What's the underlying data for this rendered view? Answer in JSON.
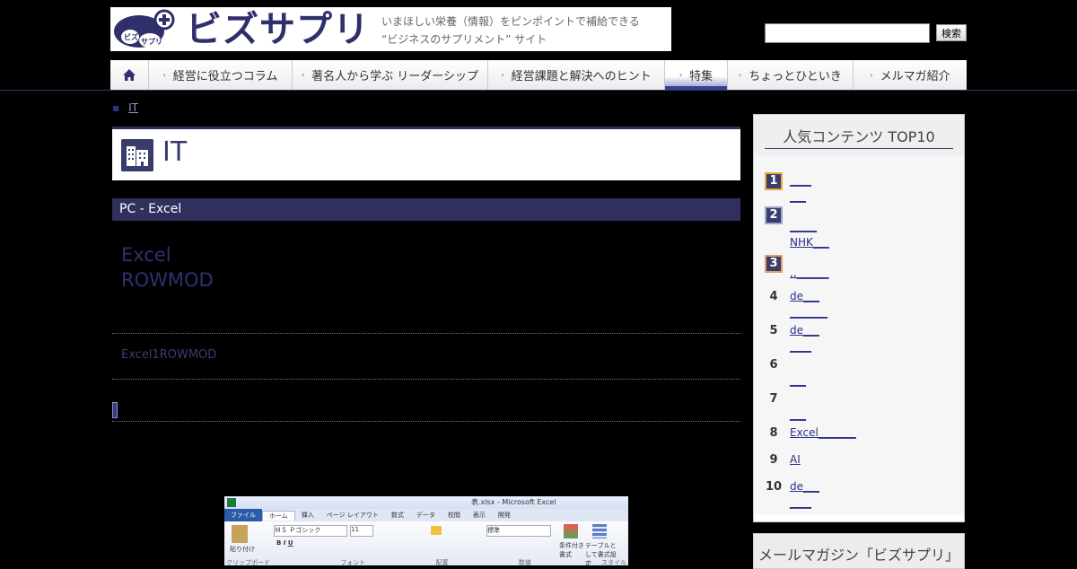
{
  "header": {
    "logo_text": "ビズサプリ",
    "tagline_1": "いまほしい栄養（情報）をピンポイントで補給できる",
    "tagline_2": "“ビジネスのサプリメント” サイト",
    "search_button": "検索",
    "search_value": ""
  },
  "nav": {
    "items": [
      {
        "label": ""
      },
      {
        "label": "経営に役立つコラム"
      },
      {
        "label": "著名人から学ぶ リーダーシップ"
      },
      {
        "label": "経営課題と解決へのヒント"
      },
      {
        "label": "特集"
      },
      {
        "label": "ちょっとひといき"
      },
      {
        "label": "メルマガ紹介"
      }
    ],
    "active": "特集"
  },
  "breadcrumb": {
    "current": "IT"
  },
  "page": {
    "title": "IT",
    "category": "PC - Excel",
    "article_title_1": "Excel",
    "article_title_2": "ROWMOD",
    "lead": "Excel1ROWMOD"
  },
  "excel_screenshot": {
    "window_title": "表.xlsx - Microsoft Excel",
    "tabs": [
      "ファイル",
      "ホーム",
      "挿入",
      "ページ レイアウト",
      "数式",
      "データ",
      "校閲",
      "表示",
      "開発"
    ],
    "font_name": "ＭＳ Ｐゴシック",
    "font_size": "11",
    "number_format": "標準",
    "group_labels": [
      "クリップボード",
      "フォント",
      "配置",
      "数値",
      "スタイル"
    ],
    "buttons": [
      "貼り付け",
      "条件付き書式",
      "テーブルとして書式設定",
      "セ スタ"
    ]
  },
  "sidebar": {
    "ranking_title": "人気コンテンツ TOP10",
    "ranking": [
      {
        "rank": "1",
        "lines": [
          "____",
          "___"
        ]
      },
      {
        "rank": "2",
        "lines": [
          "_____",
          "NHK___"
        ]
      },
      {
        "rank": "3",
        "lines": [
          ",,______"
        ]
      },
      {
        "rank": "4",
        "lines": [
          "de___",
          "_______"
        ]
      },
      {
        "rank": "5",
        "lines": [
          "de___",
          "____"
        ]
      },
      {
        "rank": "6",
        "lines": [
          "",
          "___"
        ]
      },
      {
        "rank": "7",
        "lines": [
          "",
          "___"
        ]
      },
      {
        "rank": "8",
        "lines": [
          "Excel_______"
        ]
      },
      {
        "rank": "9",
        "lines": [
          "AI"
        ]
      },
      {
        "rank": "10",
        "lines": [
          "de___",
          "____"
        ]
      }
    ],
    "magazine_title": "メールマガジン「ビズサプリ」"
  }
}
